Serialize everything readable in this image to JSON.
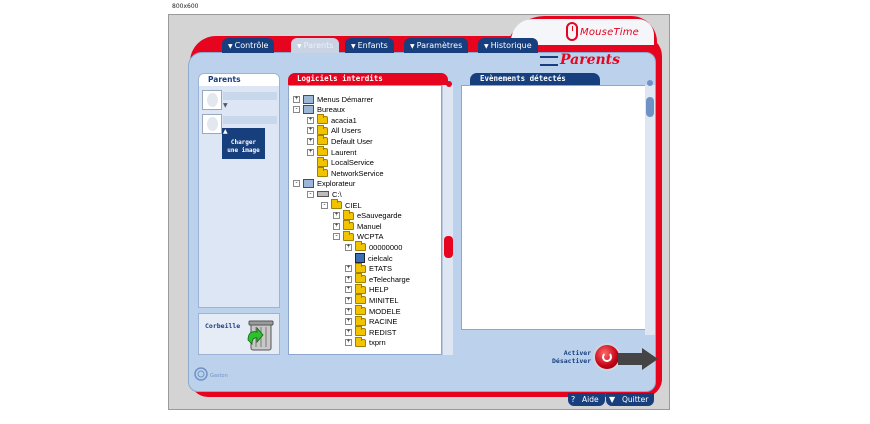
{
  "caption": "800x600",
  "brand": {
    "mousetime": "MouseTime",
    "logo": "Parents",
    "accent": "#e6041f",
    "navy": "#173f7d"
  },
  "tabs": [
    {
      "label": "Contrôle",
      "active": false
    },
    {
      "label": "Parents",
      "active": true
    },
    {
      "label": "Enfants",
      "active": false
    },
    {
      "label": "Paramètres",
      "active": false
    },
    {
      "label": "Historique",
      "active": false
    }
  ],
  "parents": {
    "title": "Parents",
    "charger_label_1": "Charger",
    "charger_label_2": "une image",
    "corbeille": "Corbeille"
  },
  "logiciels": {
    "title": "Logiciels interdits",
    "tree": [
      {
        "label": "Menus Démarrer",
        "icon": "computer",
        "exp": "+"
      },
      {
        "label": "Bureaux",
        "icon": "computer",
        "exp": "-"
      },
      {
        "label": "acacia1",
        "icon": "folder",
        "exp": "+"
      },
      {
        "label": "All Users",
        "icon": "folder",
        "exp": "+"
      },
      {
        "label": "Default User",
        "icon": "folder",
        "exp": "+"
      },
      {
        "label": "Laurent",
        "icon": "folder",
        "exp": "+"
      },
      {
        "label": "LocalService",
        "icon": "folder",
        "exp": ""
      },
      {
        "label": "NetworkService",
        "icon": "folder",
        "exp": ""
      },
      {
        "label": "Explorateur",
        "icon": "computer",
        "exp": "-"
      },
      {
        "label": "C:\\",
        "icon": "drive",
        "exp": "-"
      },
      {
        "label": "CIEL",
        "icon": "folder",
        "exp": "-"
      },
      {
        "label": "eSauvegarde",
        "icon": "folder",
        "exp": "+"
      },
      {
        "label": "Manuel",
        "icon": "folder",
        "exp": "+"
      },
      {
        "label": "WCPTA",
        "icon": "folder",
        "exp": "-"
      },
      {
        "label": "00000000",
        "icon": "folder",
        "exp": "+"
      },
      {
        "label": "cielcalc",
        "icon": "app",
        "exp": ""
      },
      {
        "label": "ETATS",
        "icon": "folder",
        "exp": "+"
      },
      {
        "label": "eTelecharge",
        "icon": "folder",
        "exp": "+"
      },
      {
        "label": "HELP",
        "icon": "folder",
        "exp": "+"
      },
      {
        "label": "MINITEL",
        "icon": "folder",
        "exp": "+"
      },
      {
        "label": "MODELE",
        "icon": "folder",
        "exp": "+"
      },
      {
        "label": "RACINE",
        "icon": "folder",
        "exp": "+"
      },
      {
        "label": "REDIST",
        "icon": "folder",
        "exp": "+"
      },
      {
        "label": "txprn",
        "icon": "folder",
        "exp": "+"
      }
    ]
  },
  "evenements": {
    "title": "Evènements détectés"
  },
  "activer": {
    "line1": "Activer",
    "line2": "Désactiver"
  },
  "footer": {
    "gaston": "Gaston",
    "aide": "Aide",
    "quitter": "Quitter"
  }
}
